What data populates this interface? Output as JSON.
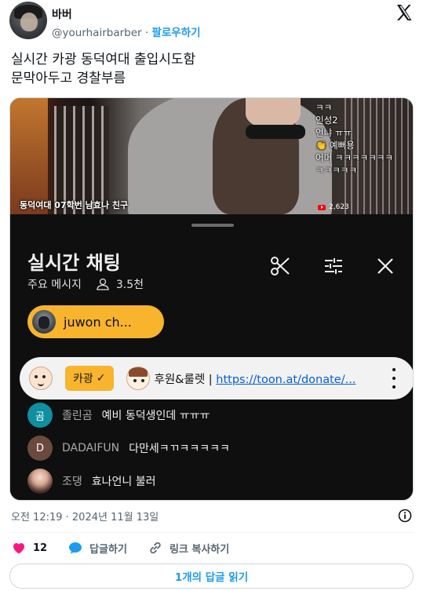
{
  "author": {
    "display_name": "바버",
    "handle": "@yourhairbarber",
    "separator": "·",
    "follow_label": "팔로우하기"
  },
  "tweet": {
    "text": "실시간 카광 동덕여대 출입시도함\n문막아두고 경찰부름",
    "timestamp": "오전 12:19 · 2024년 11월 13일"
  },
  "video": {
    "overlay_chat": "ㅋㅋ\n인성2\n언냐 ㅠㅠ\n👏 예뻐용\n어머 ㅋㅋㅋㅋㅋㅋㅋ\nㅋㅋㅋㅋㅋ",
    "caption": "동덕여대 07학번 남효나 친구",
    "views": "2,623"
  },
  "chat": {
    "title": "실시간 채팅",
    "mode": "주요 메시지",
    "viewer_count": "3.5천",
    "pill_label": "juwon ch...",
    "pinned": {
      "badge": "카광",
      "badge_check": "✓",
      "text": "후원&룰렛 | ",
      "link": "https://toon.at/donate/..."
    },
    "messages": [
      {
        "avatar_letter": "곰",
        "avatar_color": "#0f8fa0",
        "author": "졸린곰",
        "text": "예비 동덕생인데 ㅠㅠㅠ"
      },
      {
        "avatar_letter": "D",
        "avatar_color": "#6b4a3e",
        "author": "DADAIFUN",
        "text": "다만세ㅋㄲㅋㅋㅋㅋㅋ"
      },
      {
        "avatar_letter": "",
        "avatar_color": "",
        "author": "조댕",
        "text": "효나언니 불러"
      }
    ]
  },
  "actions": {
    "like_count": "12",
    "reply_label": "답글하기",
    "copy_link_label": "링크 복사하기",
    "read_replies_label": "1개의 답글 읽기"
  },
  "colors": {
    "accent": "#1d9bf0",
    "like": "#f91880",
    "pill": "#f7b42c",
    "chat_bg": "#0f0f0f"
  }
}
